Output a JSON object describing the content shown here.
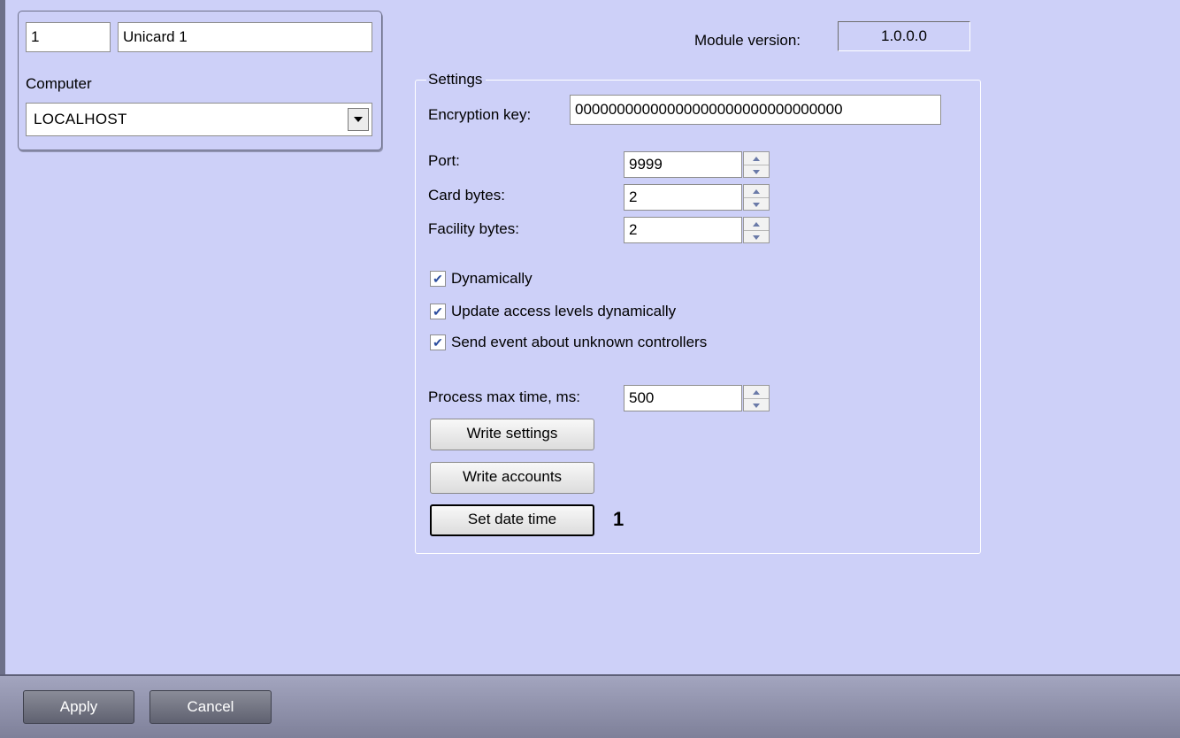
{
  "object": {
    "id": "1",
    "name": "Unicard 1",
    "computer_label": "Computer",
    "computer_value": "LOCALHOST"
  },
  "module": {
    "version_label": "Module version:",
    "version_value": "1.0.0.0"
  },
  "settings": {
    "group_title": "Settings",
    "encryption_key_label": "Encryption key:",
    "encryption_key_value": "00000000000000000000000000000000",
    "port_label": "Port:",
    "port_value": "9999",
    "card_bytes_label": "Card bytes:",
    "card_bytes_value": "2",
    "facility_bytes_label": "Facility bytes:",
    "facility_bytes_value": "2",
    "checkboxes": [
      {
        "label": "Dynamically",
        "checked": true
      },
      {
        "label": "Update access levels dynamically",
        "checked": true
      },
      {
        "label": "Send event about unknown controllers",
        "checked": true
      }
    ],
    "process_max_time_label": "Process max time, ms:",
    "process_max_time_value": "500",
    "write_settings_label": "Write settings",
    "write_accounts_label": "Write accounts",
    "set_date_time_label": "Set date time",
    "callout_marker": "1"
  },
  "footer": {
    "apply_label": "Apply",
    "cancel_label": "Cancel"
  },
  "icons": {
    "check": "checkmark-icon",
    "dropdown": "chevron-down-icon",
    "spin_up": "spin-up-icon",
    "spin_down": "spin-down-icon"
  }
}
